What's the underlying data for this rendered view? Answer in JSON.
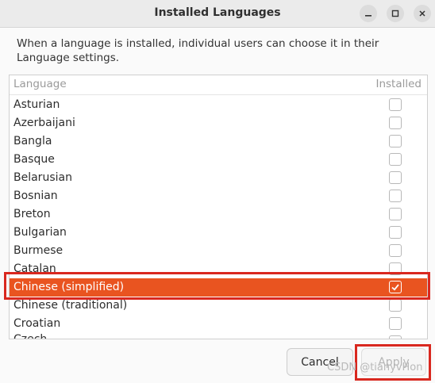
{
  "window": {
    "title": "Installed Languages"
  },
  "description": "When a language is installed, individual users can choose it in their Language settings.",
  "list": {
    "header_language": "Language",
    "header_installed": "Installed",
    "items": [
      {
        "label": "Asturian",
        "installed": false
      },
      {
        "label": "Azerbaijani",
        "installed": false
      },
      {
        "label": "Bangla",
        "installed": false
      },
      {
        "label": "Basque",
        "installed": false
      },
      {
        "label": "Belarusian",
        "installed": false
      },
      {
        "label": "Bosnian",
        "installed": false
      },
      {
        "label": "Breton",
        "installed": false
      },
      {
        "label": "Bulgarian",
        "installed": false
      },
      {
        "label": "Burmese",
        "installed": false
      },
      {
        "label": "Catalan",
        "installed": false
      },
      {
        "label": "Chinese (simplified)",
        "installed": true,
        "selected": true
      },
      {
        "label": "Chinese (traditional)",
        "installed": false
      },
      {
        "label": "Croatian",
        "installed": false
      },
      {
        "label": "Czech",
        "installed": false
      }
    ]
  },
  "buttons": {
    "cancel": "Cancel",
    "apply": "Apply"
  },
  "watermark": "CSDN @tianyvHon",
  "colors": {
    "accent": "#e95420",
    "annotation": "#d9281f"
  }
}
